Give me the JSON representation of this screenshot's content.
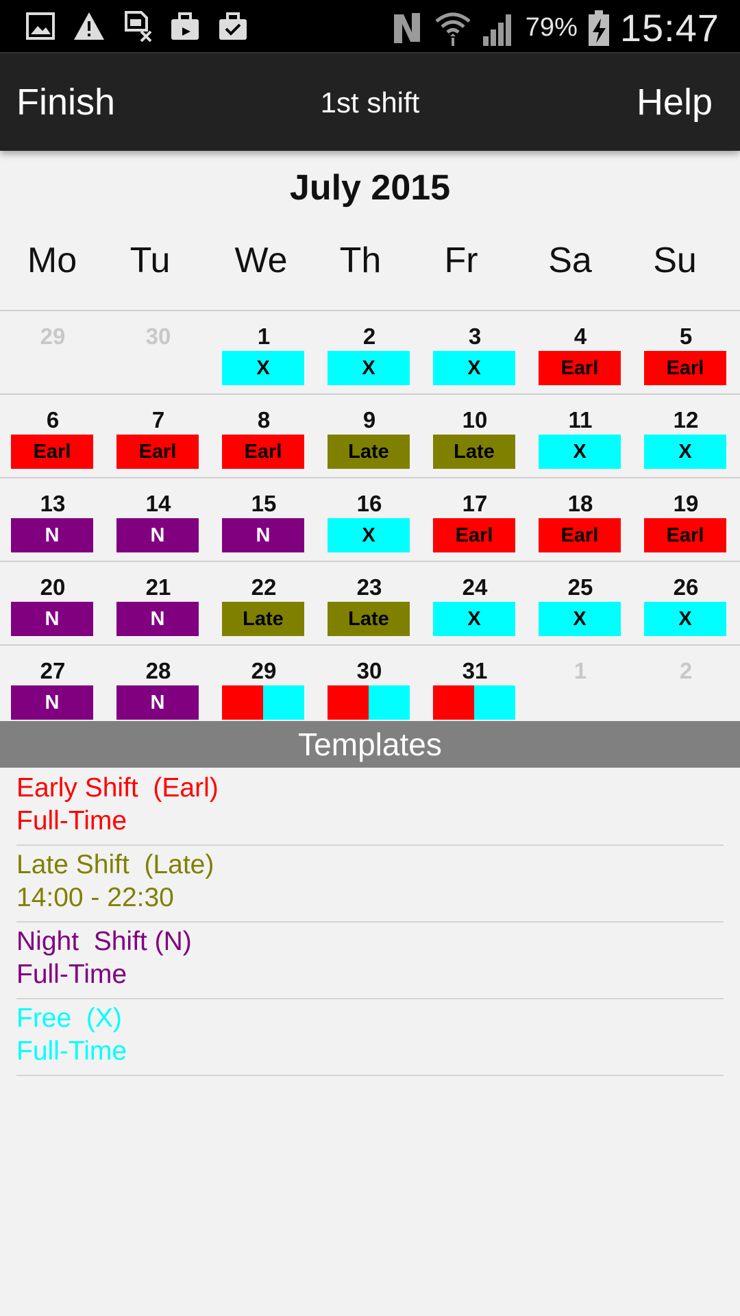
{
  "status_bar": {
    "battery": "79%",
    "time": "15:47",
    "left_icons": [
      "image-icon",
      "warning-icon",
      "sim-error-icon",
      "upload-case-icon",
      "briefcase-check-icon"
    ],
    "right_icons": [
      "nfc-icon",
      "wifi-icon",
      "signal-icon",
      "battery-charging-icon"
    ]
  },
  "app_bar": {
    "finish": "Finish",
    "title": "1st shift",
    "help": "Help"
  },
  "calendar": {
    "month_title": "July 2015",
    "weekdays": [
      "Mo",
      "Tu",
      "We",
      "Th",
      "Fr",
      "Sa",
      "Su"
    ],
    "weeks": [
      [
        {
          "day": "29",
          "muted": true
        },
        {
          "day": "30",
          "muted": true
        },
        {
          "day": "1",
          "shift": "X"
        },
        {
          "day": "2",
          "shift": "X"
        },
        {
          "day": "3",
          "shift": "X"
        },
        {
          "day": "4",
          "shift": "Earl"
        },
        {
          "day": "5",
          "shift": "Earl"
        }
      ],
      [
        {
          "day": "6",
          "shift": "Earl"
        },
        {
          "day": "7",
          "shift": "Earl"
        },
        {
          "day": "8",
          "shift": "Earl"
        },
        {
          "day": "9",
          "shift": "Late"
        },
        {
          "day": "10",
          "shift": "Late"
        },
        {
          "day": "11",
          "shift": "X"
        },
        {
          "day": "12",
          "shift": "X"
        }
      ],
      [
        {
          "day": "13",
          "shift": "N"
        },
        {
          "day": "14",
          "shift": "N"
        },
        {
          "day": "15",
          "shift": "N"
        },
        {
          "day": "16",
          "shift": "X"
        },
        {
          "day": "17",
          "shift": "Earl"
        },
        {
          "day": "18",
          "shift": "Earl"
        },
        {
          "day": "19",
          "shift": "Earl"
        }
      ],
      [
        {
          "day": "20",
          "shift": "N"
        },
        {
          "day": "21",
          "shift": "N"
        },
        {
          "day": "22",
          "shift": "Late"
        },
        {
          "day": "23",
          "shift": "Late"
        },
        {
          "day": "24",
          "shift": "X"
        },
        {
          "day": "25",
          "shift": "X"
        },
        {
          "day": "26",
          "shift": "X"
        }
      ],
      [
        {
          "day": "27",
          "shift": "N"
        },
        {
          "day": "28",
          "shift": "N"
        },
        {
          "day": "29",
          "split": [
            "Earl",
            "X"
          ]
        },
        {
          "day": "30",
          "split": [
            "Earl",
            "X"
          ]
        },
        {
          "day": "31",
          "split": [
            "Earl",
            "X"
          ]
        },
        {
          "day": "1",
          "muted": true
        },
        {
          "day": "2",
          "muted": true
        }
      ]
    ]
  },
  "shift_styles": {
    "Earl": {
      "bg": "#ff0000",
      "fg": "#000000"
    },
    "Late": {
      "bg": "#808000",
      "fg": "#000000"
    },
    "N": {
      "bg": "#800080",
      "fg": "#ffffff"
    },
    "X": {
      "bg": "#00ffff",
      "fg": "#000000"
    }
  },
  "templates": {
    "header": "Templates",
    "items": [
      {
        "line1": "Early Shift  (Earl)",
        "line2": "Full-Time",
        "color": "#ff0000"
      },
      {
        "line1": "Late Shift  (Late)",
        "line2": "14:00 - 22:30",
        "color": "#808000"
      },
      {
        "line1": "Night  Shift (N)",
        "line2": "Full-Time",
        "color": "#800080"
      },
      {
        "line1": "Free  (X)",
        "line2": "Full-Time",
        "color": "#00ffff"
      }
    ]
  }
}
